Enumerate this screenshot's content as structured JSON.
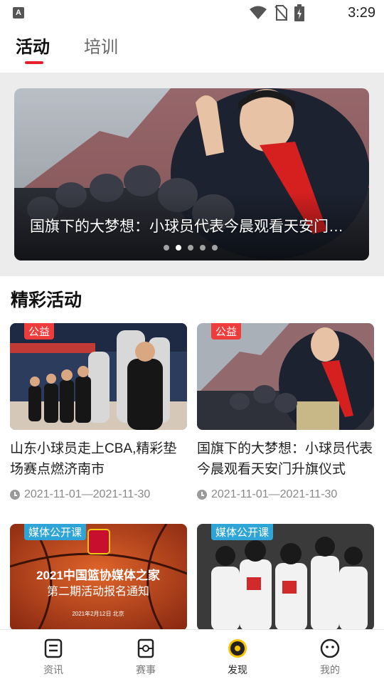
{
  "status_bar": {
    "time": "3:29",
    "app_badge": "A"
  },
  "tabs": [
    {
      "label": "活动",
      "active": true
    },
    {
      "label": "培训",
      "active": false
    }
  ],
  "banner": {
    "title": "国旗下的大梦想：小球员代表今晨观看天安门升旗仪式",
    "dots": 5,
    "active_dot": 2
  },
  "section": {
    "title": "精彩活动"
  },
  "cards": [
    {
      "tag": "公益",
      "title": "山东小球员走上CBA,精彩垫场赛点燃济南市",
      "date": "2021-11-01—2021-11-30"
    },
    {
      "tag": "公益",
      "title": "国旗下的大梦想：小球员代表今晨观看天安门升旗仪式",
      "date": "2021-11-01—2021-11-30"
    },
    {
      "tag": "媒体公开课",
      "poster_line1": "2021中国篮协媒体之家",
      "poster_line2": "第二期活动报名通知",
      "poster_date": "2021年2月12日  北京"
    },
    {
      "tag": "媒体公开课"
    }
  ],
  "bottom_nav": [
    {
      "label": "资讯",
      "icon": "news-icon"
    },
    {
      "label": "赛事",
      "icon": "court-icon"
    },
    {
      "label": "发现",
      "icon": "discover-icon",
      "active": true
    },
    {
      "label": "我的",
      "icon": "profile-icon"
    }
  ],
  "colors": {
    "accent": "#e8202a",
    "tag_red": "#ee3b3b",
    "tag_blue": "#2fa4d6"
  }
}
